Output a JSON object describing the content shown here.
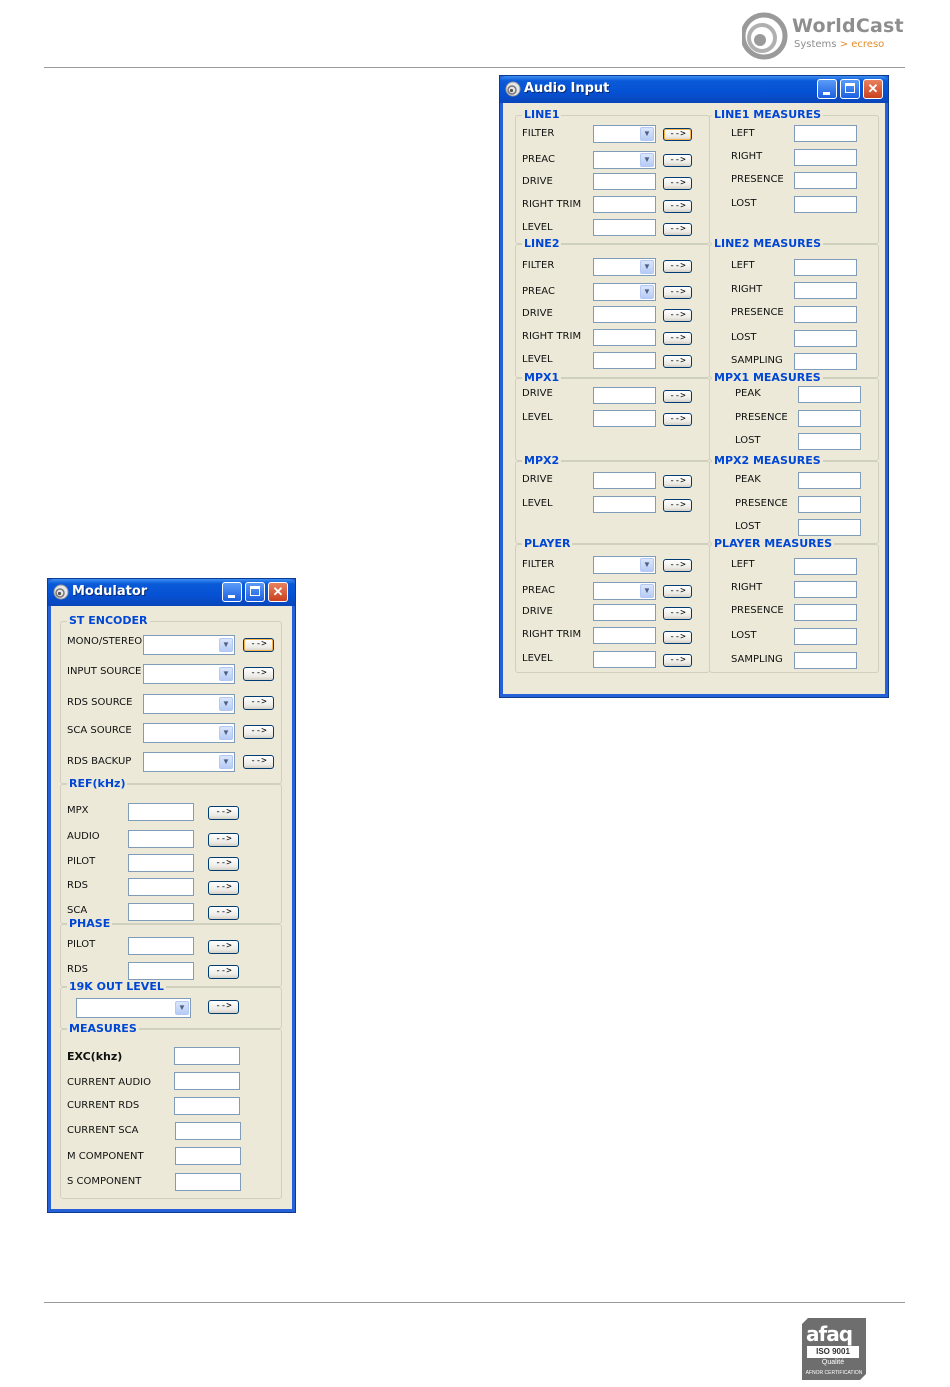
{
  "header": {
    "logo_word": "WorldCast",
    "logo_sub": "Systems",
    "logo_sub_sep": ">",
    "logo_sub_accent": "ecreso"
  },
  "footer": {
    "afaq_word": "afaq",
    "afaq_iso": "ISO 9001",
    "afaq_quality": "Qualité",
    "afaq_cert": "AFNOR CERTIFICATION"
  },
  "colors": {
    "titlebar": "#0651d4",
    "group_title": "#0046d5",
    "window_bg": "#ece9d8",
    "close_button": "#c9401e"
  },
  "audio_window": {
    "title": "Audio Input",
    "apply_label": "-->",
    "line1": {
      "title": "LINE1",
      "filter": "FILTER",
      "preac": "PREAC",
      "drive": "DRIVE",
      "right_trim": "RIGHT TRIM",
      "level": "LEVEL"
    },
    "line1_measures": {
      "title": "LINE1 MEASURES",
      "left": "LEFT",
      "right": "RIGHT",
      "presence": "PRESENCE",
      "lost": "LOST"
    },
    "line2": {
      "title": "LINE2",
      "filter": "FILTER",
      "preac": "PREAC",
      "drive": "DRIVE",
      "right_trim": "RIGHT TRIM",
      "level": "LEVEL"
    },
    "line2_measures": {
      "title": "LINE2 MEASURES",
      "left": "LEFT",
      "right": "RIGHT",
      "presence": "PRESENCE",
      "lost": "LOST",
      "sampling": "SAMPLING"
    },
    "mpx1": {
      "title": "MPX1",
      "drive": "DRIVE",
      "level": "LEVEL"
    },
    "mpx1_measures": {
      "title": "MPX1 MEASURES",
      "peak": "PEAK",
      "presence": "PRESENCE",
      "lost": "LOST"
    },
    "mpx2": {
      "title": "MPX2",
      "drive": "DRIVE",
      "level": "LEVEL"
    },
    "mpx2_measures": {
      "title": "MPX2 MEASURES",
      "peak": "PEAK",
      "presence": "PRESENCE",
      "lost": "LOST"
    },
    "player": {
      "title": "PLAYER",
      "filter": "FILTER",
      "preac": "PREAC",
      "drive": "DRIVE",
      "right_trim": "RIGHT TRIM",
      "level": "LEVEL"
    },
    "player_measures": {
      "title": "PLAYER MEASURES",
      "left": "LEFT",
      "right": "RIGHT",
      "presence": "PRESENCE",
      "lost": "LOST",
      "sampling": "SAMPLING"
    }
  },
  "modulator_window": {
    "title": "Modulator",
    "apply_label": "-->",
    "st_encoder": {
      "title": "ST ENCODER",
      "mono_stereo": "MONO/STEREO",
      "input_source": "INPUT SOURCE",
      "rds_source": "RDS SOURCE",
      "sca_source": "SCA SOURCE",
      "rds_backup": "RDS BACKUP"
    },
    "ref": {
      "title": "REF(kHz)",
      "mpx": "MPX",
      "audio": "AUDIO",
      "pilot": "PILOT",
      "rds": "RDS",
      "sca": "SCA"
    },
    "phase": {
      "title": "PHASE",
      "pilot": "PILOT",
      "rds": "RDS"
    },
    "out19k": {
      "title": "19K OUT LEVEL"
    },
    "measures": {
      "title": "MEASURES",
      "exc": "EXC(khz)",
      "current_audio": "CURRENT AUDIO",
      "current_rds": "CURRENT RDS",
      "current_sca": "CURRENT SCA",
      "m_component": "M COMPONENT",
      "s_component": "S COMPONENT"
    }
  }
}
